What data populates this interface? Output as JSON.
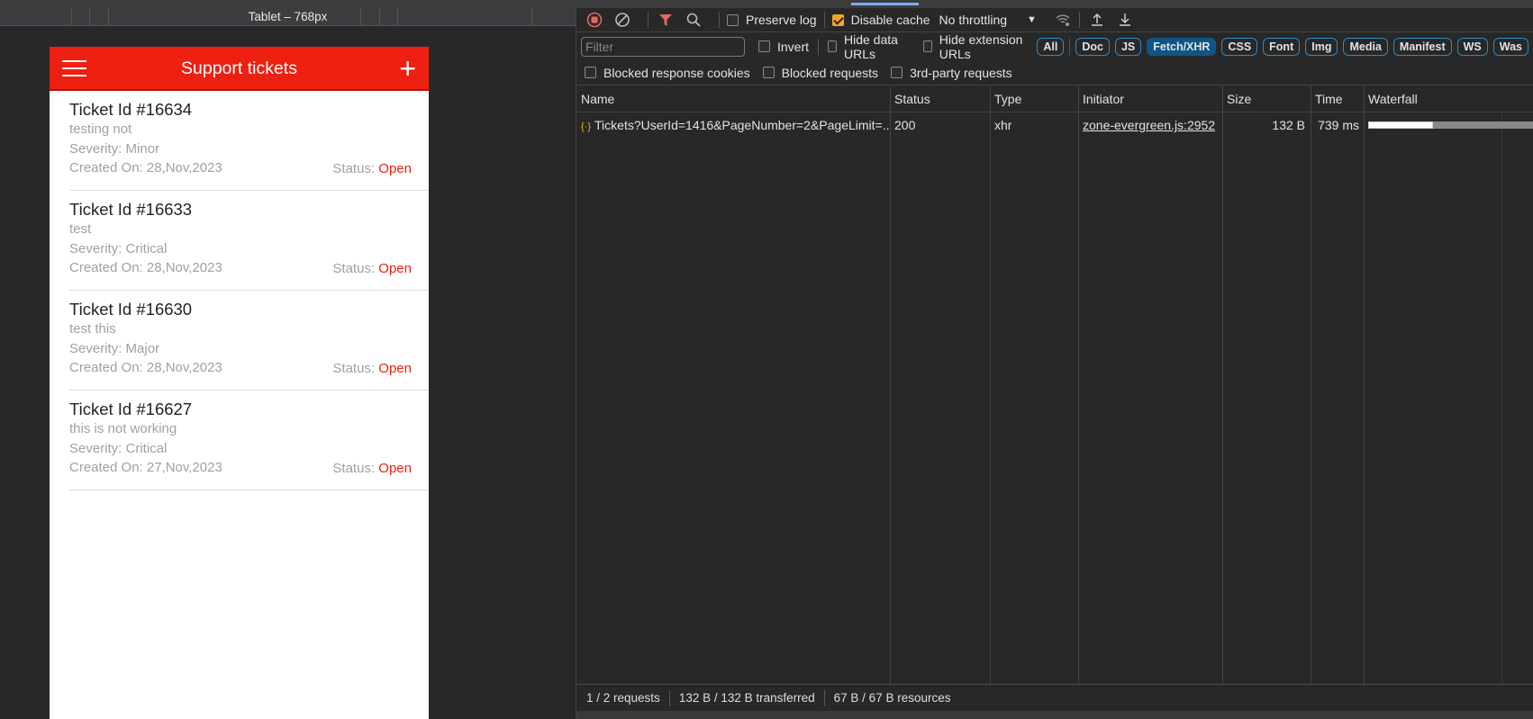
{
  "device_toolbar": {
    "label": "Tablet – 768px"
  },
  "app": {
    "title": "Support tickets",
    "menu_icon": "hamburger-icon",
    "add_icon": "plus-icon",
    "accent": "#ee2011",
    "tickets": [
      {
        "id": "Ticket Id #16634",
        "desc": "testing not",
        "severity": "Severity: Minor",
        "created": "Created On: 28,Nov,2023",
        "status_label": "Status:",
        "status": "Open"
      },
      {
        "id": "Ticket Id #16633",
        "desc": "test",
        "severity": "Severity: Critical",
        "created": "Created On: 28,Nov,2023",
        "status_label": "Status:",
        "status": "Open"
      },
      {
        "id": "Ticket Id #16630",
        "desc": "test this",
        "severity": "Severity: Major",
        "created": "Created On: 28,Nov,2023",
        "status_label": "Status:",
        "status": "Open"
      },
      {
        "id": "Ticket Id #16627",
        "desc": "this is not working",
        "severity": "Severity: Critical",
        "created": "Created On: 27,Nov,2023",
        "status_label": "Status:",
        "status": "Open"
      }
    ]
  },
  "devtools": {
    "toolbar": {
      "preserve_log": "Preserve log",
      "disable_cache": "Disable cache",
      "disable_cache_checked": true,
      "throttling": "No throttling"
    },
    "filter": {
      "placeholder": "Filter",
      "invert": "Invert",
      "hide_data_urls": "Hide data URLs",
      "hide_extension_urls": "Hide extension URLs"
    },
    "types": [
      "All",
      "Doc",
      "JS",
      "Fetch/XHR",
      "CSS",
      "Font",
      "Img",
      "Media",
      "Manifest",
      "WS",
      "Was"
    ],
    "active_type": "Fetch/XHR",
    "blocked": {
      "cookies": "Blocked response cookies",
      "requests": "Blocked requests",
      "third_party": "3rd-party requests"
    },
    "columns": [
      "Name",
      "Status",
      "Type",
      "Initiator",
      "Size",
      "Time",
      "Waterfall"
    ],
    "rows": [
      {
        "name": "Tickets?UserId=1416&PageNumber=2&PageLimit=...",
        "status": "200",
        "type": "xhr",
        "initiator": "zone-evergreen.js:2952",
        "size": "132 B",
        "time": "739 ms"
      }
    ],
    "footer": {
      "requests": "1 / 2 requests",
      "transferred": "132 B / 132 B transferred",
      "resources": "67 B / 67 B resources"
    }
  }
}
